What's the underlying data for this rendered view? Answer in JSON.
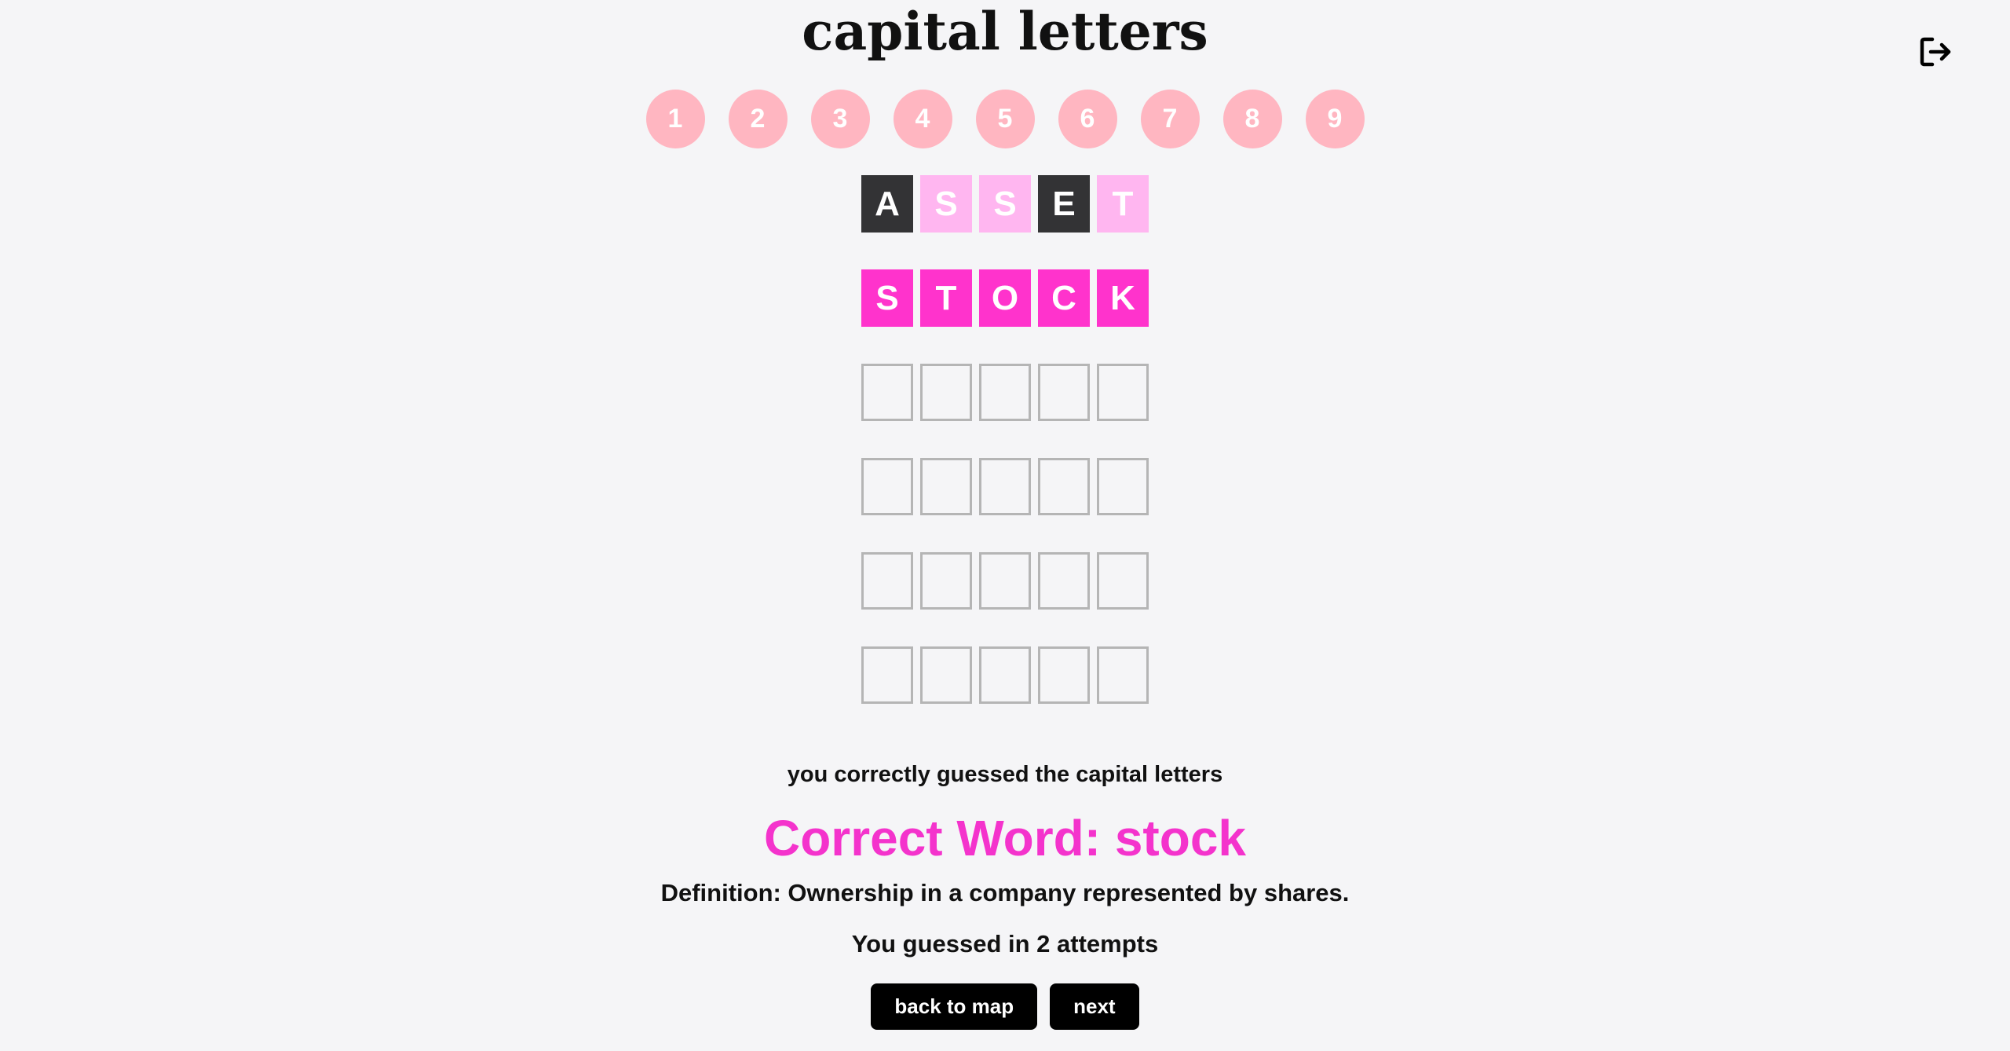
{
  "header": {
    "title": "capital letters",
    "logout_icon": "logout-icon"
  },
  "levels": [
    "1",
    "2",
    "3",
    "4",
    "5",
    "6",
    "7",
    "8",
    "9"
  ],
  "board": {
    "rows": [
      [
        {
          "letter": "A",
          "state": "absent"
        },
        {
          "letter": "S",
          "state": "present"
        },
        {
          "letter": "S",
          "state": "present"
        },
        {
          "letter": "E",
          "state": "absent"
        },
        {
          "letter": "T",
          "state": "present"
        }
      ],
      [
        {
          "letter": "S",
          "state": "correct"
        },
        {
          "letter": "T",
          "state": "correct"
        },
        {
          "letter": "O",
          "state": "correct"
        },
        {
          "letter": "C",
          "state": "correct"
        },
        {
          "letter": "K",
          "state": "correct"
        }
      ],
      [
        {
          "letter": "",
          "state": "empty"
        },
        {
          "letter": "",
          "state": "empty"
        },
        {
          "letter": "",
          "state": "empty"
        },
        {
          "letter": "",
          "state": "empty"
        },
        {
          "letter": "",
          "state": "empty"
        }
      ],
      [
        {
          "letter": "",
          "state": "empty"
        },
        {
          "letter": "",
          "state": "empty"
        },
        {
          "letter": "",
          "state": "empty"
        },
        {
          "letter": "",
          "state": "empty"
        },
        {
          "letter": "",
          "state": "empty"
        }
      ],
      [
        {
          "letter": "",
          "state": "empty"
        },
        {
          "letter": "",
          "state": "empty"
        },
        {
          "letter": "",
          "state": "empty"
        },
        {
          "letter": "",
          "state": "empty"
        },
        {
          "letter": "",
          "state": "empty"
        }
      ],
      [
        {
          "letter": "",
          "state": "empty"
        },
        {
          "letter": "",
          "state": "empty"
        },
        {
          "letter": "",
          "state": "empty"
        },
        {
          "letter": "",
          "state": "empty"
        },
        {
          "letter": "",
          "state": "empty"
        }
      ]
    ]
  },
  "result": {
    "message": "you correctly guessed the capital letters",
    "correct_word": "Correct Word: stock",
    "definition": "Definition: Ownership in a company represented by shares.",
    "attempts": "You guessed in 2 attempts"
  },
  "buttons": {
    "back_label": "back to map",
    "next_label": "next"
  },
  "colors": {
    "level_circle": "#ffb6c1",
    "absent": "#333335",
    "present": "#ffb6f0",
    "correct": "#ff33cc",
    "correct_word_text": "#f433cc",
    "background": "#f5f5f7"
  }
}
